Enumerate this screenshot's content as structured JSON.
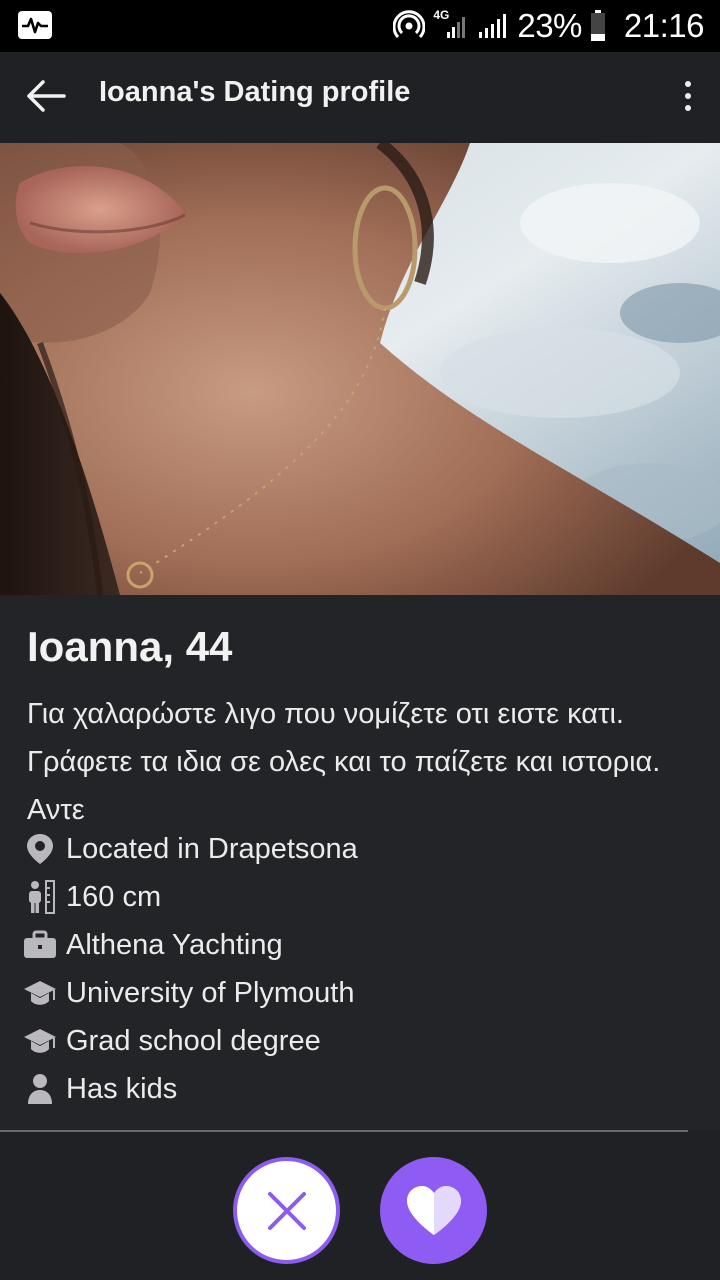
{
  "status_bar": {
    "network": "4G",
    "battery_percent": "23%",
    "time": "21:16"
  },
  "app_bar": {
    "title": "Ioanna's Dating profile"
  },
  "profile": {
    "name_age": "Ioanna, 44",
    "bio": "Για χαλαρώστε λιγο που νομίζετε οτι ειστε κατι. Γράφετε τα ιδια σε ολες και το παίζετε και ιστορια. Αντε",
    "facts": [
      {
        "icon": "location-pin-icon",
        "text": "Located in Drapetsona"
      },
      {
        "icon": "height-icon",
        "text": "160 cm"
      },
      {
        "icon": "briefcase-icon",
        "text": "Althena Yachting"
      },
      {
        "icon": "graduation-cap-icon",
        "text": "University of Plymouth"
      },
      {
        "icon": "graduation-cap-icon",
        "text": "Grad school degree"
      },
      {
        "icon": "person-icon",
        "text": "Has kids"
      }
    ]
  },
  "colors": {
    "accent": "#8e5cf2",
    "background": "#1f2023",
    "icon_gray": "#b9b9bd"
  }
}
